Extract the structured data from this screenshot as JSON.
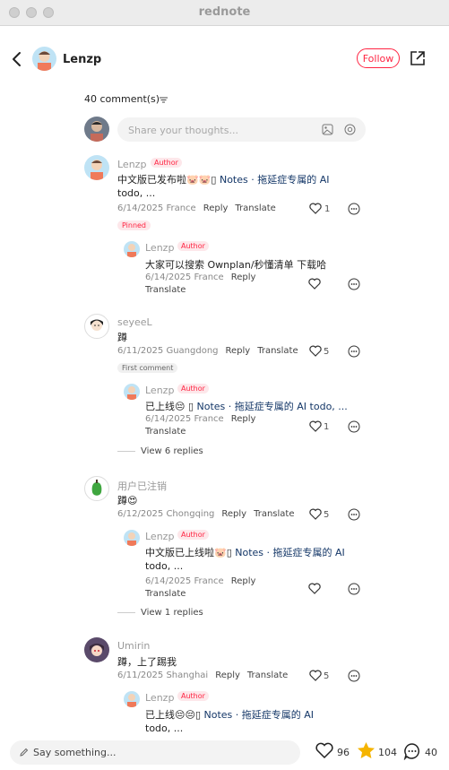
{
  "window": {
    "title": "rednote"
  },
  "header": {
    "username": "Lenzp",
    "follow_label": "Follow"
  },
  "comments_header": {
    "count_label": "40 comment(s)"
  },
  "comment_input": {
    "placeholder": "Share your thoughts..."
  },
  "comments": [
    {
      "user": "Lenzp",
      "badge": "Author",
      "text_line1_prefix": "中文版已发布啦",
      "link_text": "Notes · 拖延症专属的 AI",
      "text_line2": "todo, ...",
      "meta": "6/14/2025 France",
      "reply_label": "Reply",
      "translate_label": "Translate",
      "likes": "1",
      "pill": "Pinned",
      "replies": [
        {
          "user": "Lenzp",
          "badge": "Author",
          "text": "大家可以搜索 Ownplan/秒懂清单 下载哈",
          "meta": "6/14/2025 France",
          "reply_label": "Reply",
          "translate_label": "Translate",
          "likes": ""
        }
      ]
    },
    {
      "user": "seyeeL",
      "text": "蹲",
      "meta": "6/11/2025 Guangdong",
      "reply_label": "Reply",
      "translate_label": "Translate",
      "likes": "5",
      "pill": "First comment",
      "replies": [
        {
          "user": "Lenzp",
          "badge": "Author",
          "text_prefix": "已上线",
          "link_text": "Notes · 拖延症专属的 AI todo, ...",
          "meta": "6/14/2025 France",
          "reply_label": "Reply",
          "translate_label": "Translate",
          "likes": "1"
        }
      ],
      "view_replies": "View 6 replies"
    },
    {
      "user": "用户已注销",
      "text": "蹲",
      "meta": "6/12/2025 Chongqing",
      "reply_label": "Reply",
      "translate_label": "Translate",
      "likes": "5",
      "replies": [
        {
          "user": "Lenzp",
          "badge": "Author",
          "text_prefix": "中文版已上线啦",
          "link_text": "Notes · 拖延症专属的 AI",
          "text_line2": "todo, ...",
          "meta": "6/14/2025 France",
          "reply_label": "Reply",
          "translate_label": "Translate",
          "likes": ""
        }
      ],
      "view_replies": "View 1 replies"
    },
    {
      "user": "Umirin",
      "text": "蹲，上了踢我",
      "meta": "6/11/2025 Shanghai",
      "reply_label": "Reply",
      "translate_label": "Translate",
      "likes": "5",
      "replies": [
        {
          "user": "Lenzp",
          "badge": "Author",
          "text_prefix": "已上线",
          "link_text": "Notes · 拖延症专属的 AI",
          "text_line2": "todo, ..."
        }
      ]
    }
  ],
  "bottom_bar": {
    "placeholder": "Say something...",
    "likes": "96",
    "stars": "104",
    "comments": "40"
  },
  "colors": {
    "accent": "#ff2442",
    "link": "#133667",
    "star": "#f5b400"
  }
}
